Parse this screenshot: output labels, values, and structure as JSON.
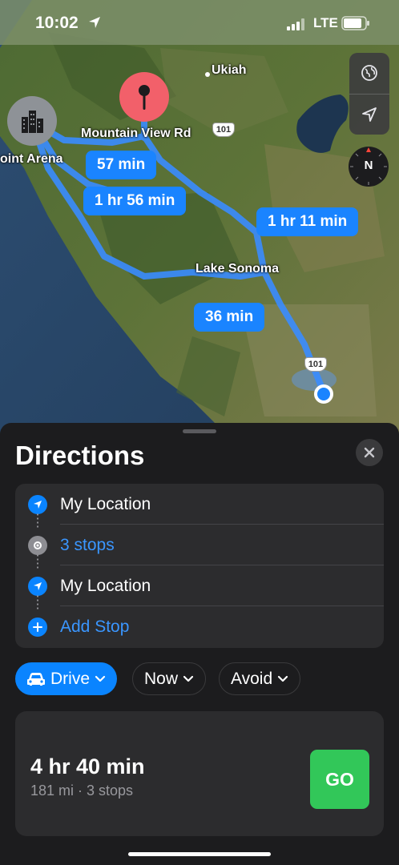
{
  "status_bar": {
    "time": "10:02",
    "network": "LTE",
    "icons": [
      "location-arrow-icon",
      "signal-bars-icon",
      "battery-icon"
    ]
  },
  "map": {
    "labels": {
      "ukiah": "Ukiah",
      "mountain_view_rd": "Mountain View Rd",
      "point_arena": "oint Arena",
      "lake_sonoma": "Lake Sonoma"
    },
    "highway_shields": [
      "101",
      "101"
    ],
    "eta_bubbles": [
      "57 min",
      "1 hr 56 min",
      "1 hr 11 min",
      "36 min"
    ],
    "controls": [
      "globe-icon",
      "location-arrow-icon"
    ],
    "compass_label": "N",
    "route_color": "#3a8cff"
  },
  "directions": {
    "title": "Directions",
    "close_icon": "close-icon",
    "stops": [
      {
        "label": "My Location",
        "icon": "location-arrow-icon",
        "color": "#ffffff"
      },
      {
        "label": "3 stops",
        "icon": "waypoints-icon",
        "color": "#3a96ff"
      },
      {
        "label": "My Location",
        "icon": "location-arrow-icon",
        "color": "#ffffff"
      },
      {
        "label": "Add Stop",
        "icon": "plus-icon",
        "color": "#3a96ff"
      }
    ],
    "options": {
      "mode": "Drive",
      "time": "Now",
      "avoid": "Avoid"
    },
    "route": {
      "duration": "4 hr 40 min",
      "summary": "181 mi · 3 stops",
      "go_label": "GO"
    }
  },
  "colors": {
    "accent": "#0a84ff",
    "go": "#32c759",
    "sheet_bg": "#1c1c1e",
    "card_bg": "#2c2c2e"
  }
}
